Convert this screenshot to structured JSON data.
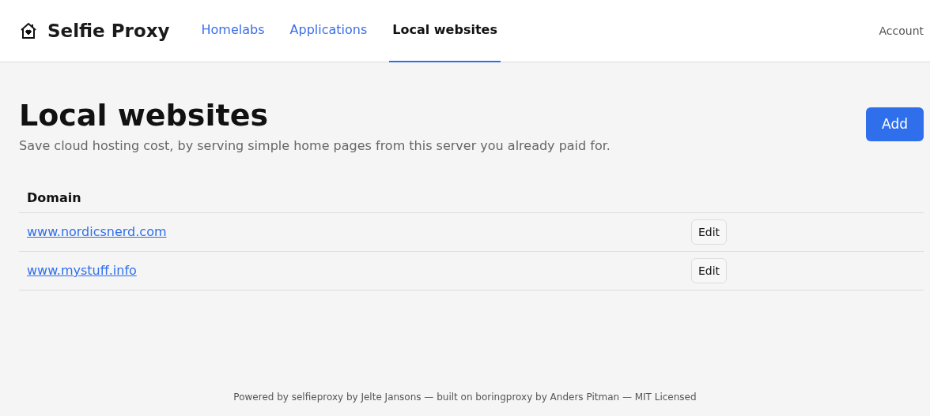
{
  "header": {
    "brand": "Selfie Proxy",
    "nav": [
      {
        "label": "Homelabs",
        "selected": false
      },
      {
        "label": "Applications",
        "selected": false
      },
      {
        "label": "Local websites",
        "selected": true
      }
    ],
    "account": "Account"
  },
  "page": {
    "title": "Local websites",
    "subtitle": "Save cloud hosting cost, by serving simple home pages from this server you already paid for.",
    "add_button": "Add"
  },
  "table": {
    "columns": [
      "Domain"
    ],
    "rows": [
      {
        "domain": "www.nordicsnerd.com",
        "action": "Edit"
      },
      {
        "domain": "www.mystuff.info",
        "action": "Edit"
      }
    ]
  },
  "footer": "Powered by selfieproxy by Jelte Jansons — built on boringproxy by Anders Pitman — MIT Licensed"
}
